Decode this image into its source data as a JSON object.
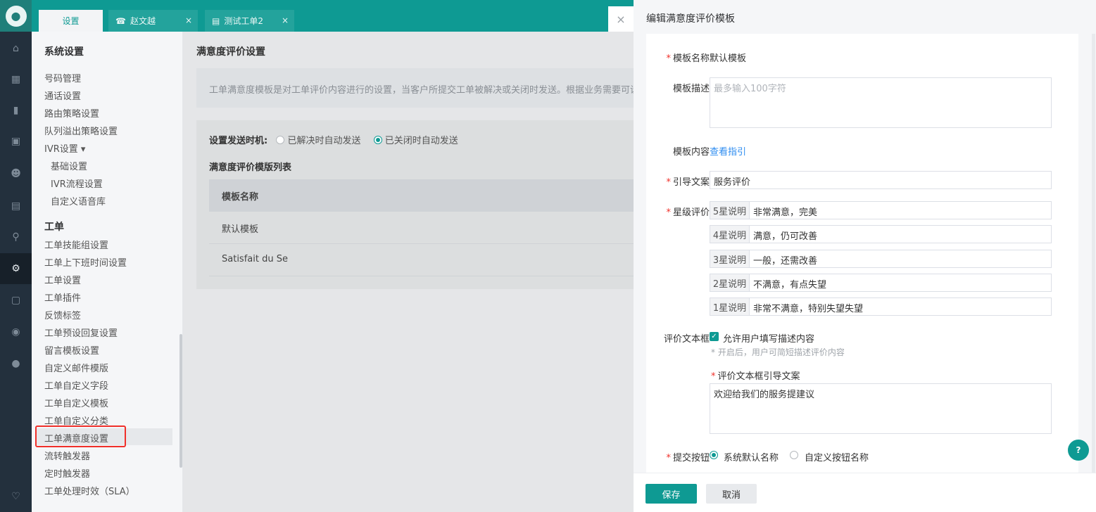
{
  "topbar": {
    "tabs": [
      {
        "label": "设置",
        "active": true
      },
      {
        "label": "赵文越",
        "closable": true
      },
      {
        "label": "测试工单2",
        "closable": true
      }
    ]
  },
  "sidebar": {
    "section_system": "系统设置",
    "system_items": [
      "号码管理",
      "通话设置",
      "路由策略设置",
      "队列溢出策略设置",
      "IVR设置 ▾"
    ],
    "ivr_sub_items": [
      "基础设置",
      "IVR流程设置",
      "自定义语音库"
    ],
    "section_ticket": "工单",
    "ticket_items": [
      "工单技能组设置",
      "工单上下班时间设置",
      "工单设置",
      "工单插件",
      "反馈标签",
      "工单预设回复设置",
      "留言模板设置",
      "自定义邮件模版",
      "工单自定义字段",
      "工单自定义模板",
      "工单自定义分类",
      "工单满意度设置",
      "流转触发器",
      "定时触发器",
      "工单处理时效（SLA）"
    ],
    "selected": "工单满意度设置"
  },
  "main": {
    "title": "满意度评价设置",
    "intro": "工单满意度模板是对工单评价内容进行的设置，当客户所提交工单被解决或关闭时发送。根据业务需要可设置",
    "timing_label": "设置发送时机:",
    "timing_options": [
      "已解决时自动发送",
      "已关闭时自动发送"
    ],
    "timing_selected": 1,
    "list_title": "满意度评价模版列表",
    "table_header": "模板名称",
    "rows": [
      "默认模板",
      "Satisfait du Se"
    ]
  },
  "drawer": {
    "title": "编辑满意度评价模板",
    "name_label": "模板名称",
    "name_value": "默认模板",
    "desc_label": "模板描述",
    "desc_placeholder": "最多输入100字符",
    "content_label": "模板内容",
    "content_link": "查看指引",
    "guide_label": "引导文案",
    "guide_value": "服务评价",
    "star_label": "星级评价",
    "stars": [
      {
        "prefix": "5星说明",
        "text": "非常满意，完美"
      },
      {
        "prefix": "4星说明",
        "text": "满意，仍可改善"
      },
      {
        "prefix": "3星说明",
        "text": "一般，还需改善"
      },
      {
        "prefix": "2星说明",
        "text": "不满意，有点失望"
      },
      {
        "prefix": "1星说明",
        "text": "非常不满意，特别失望失望"
      }
    ],
    "textbox_label": "评价文本框",
    "textbox_checkbox": "允许用户填写描述内容",
    "textbox_hint": "* 开启后，用户可简短描述评价内容",
    "textbox_guide_label": "评价文本框引导文案",
    "textbox_guide_value": "欢迎给我们的服务提建议",
    "submit_label": "提交按钮",
    "submit_options": [
      "系统默认名称",
      "自定义按钮名称"
    ],
    "save": "保存",
    "cancel": "取消",
    "required_mark": "*"
  },
  "colors": {
    "accent": "#0e9a93",
    "sidebar_bg": "#23303d",
    "highlight": "#f0302a",
    "link": "#2d8cf0"
  }
}
